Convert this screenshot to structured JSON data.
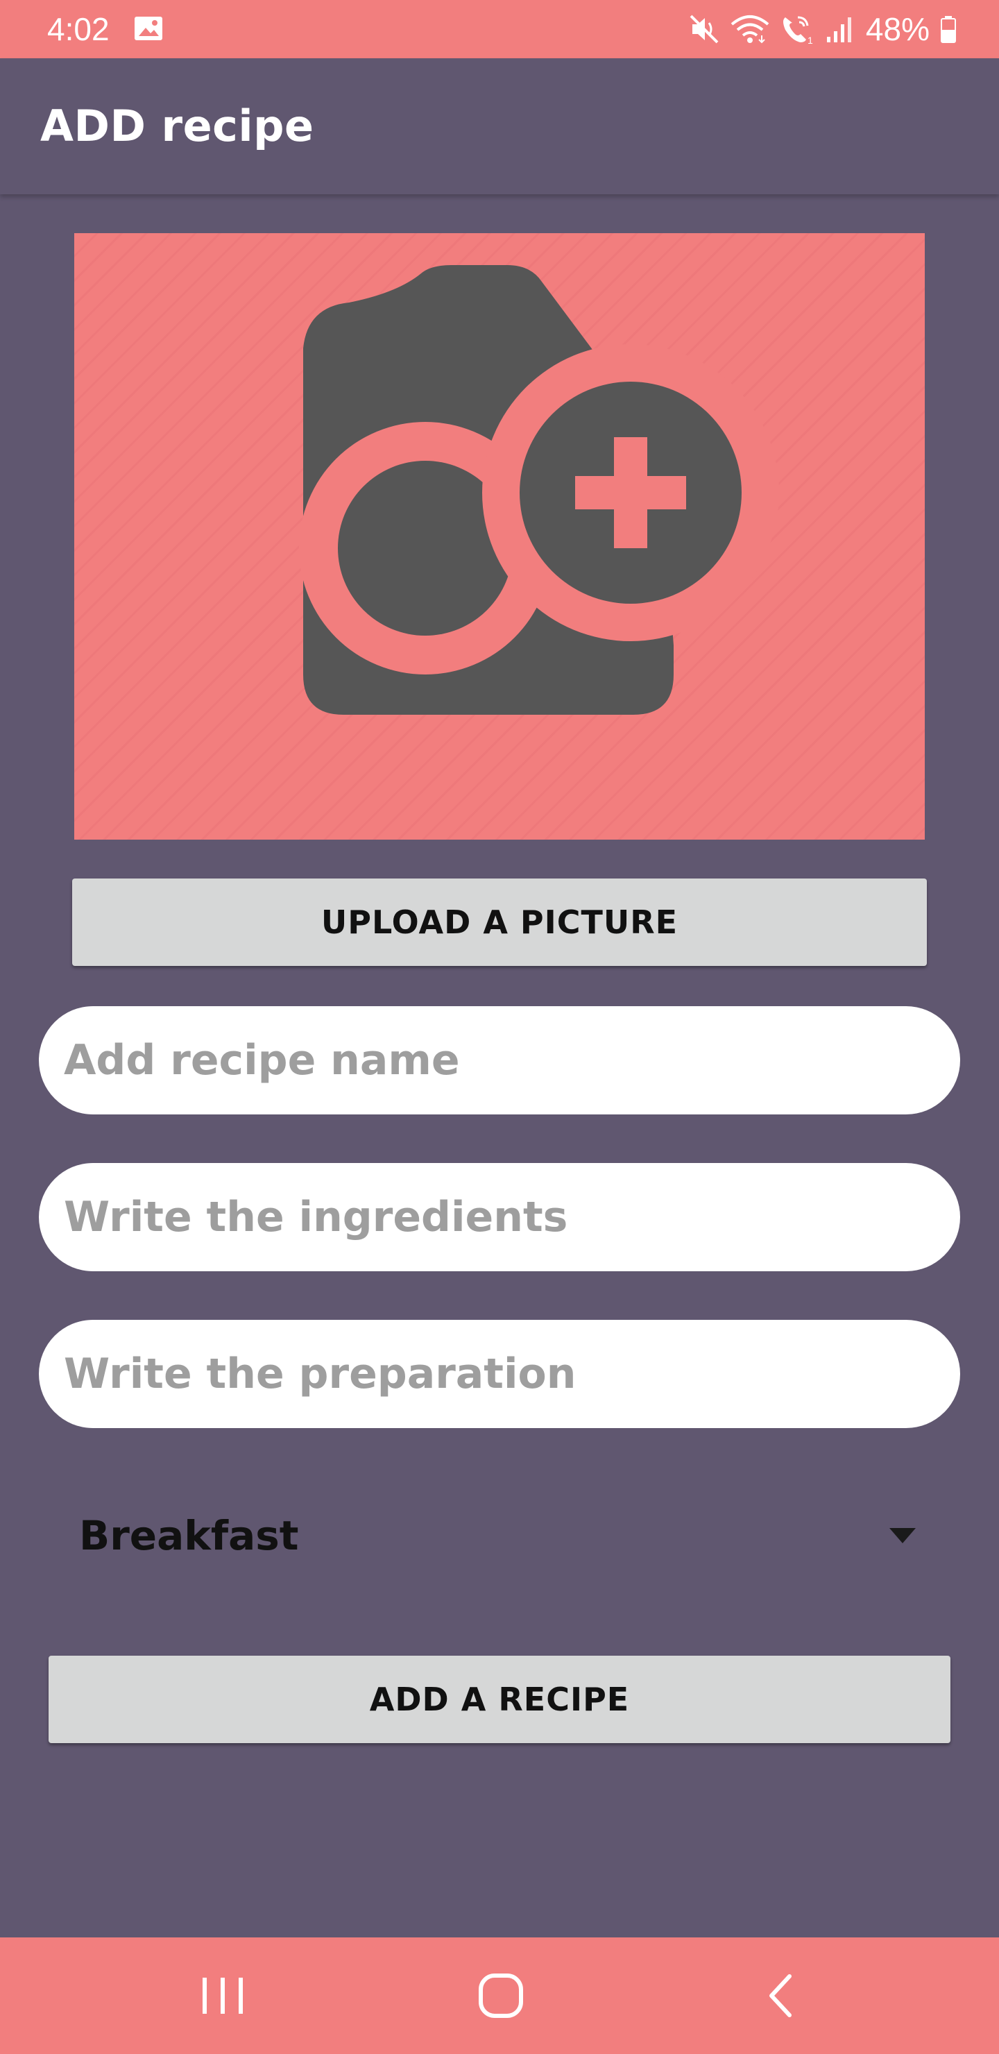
{
  "status_bar": {
    "time": "4:02",
    "battery": "48%",
    "icons": [
      "gallery-icon",
      "mute-icon",
      "wifi-icon",
      "wifi-calling-icon",
      "signal-icon",
      "battery-icon"
    ]
  },
  "app_bar": {
    "title": "ADD recipe"
  },
  "image_placeholder": {
    "icon": "add-photo-icon",
    "colors": {
      "background": "#f27e7e",
      "icon": "#565656"
    }
  },
  "upload_button": {
    "label": "UPLOAD A PICTURE"
  },
  "form": {
    "name_placeholder": "Add recipe name",
    "name_value": "",
    "ingredients_placeholder": "Write the ingredients",
    "ingredients_value": "",
    "preparation_placeholder": "Write the preparation",
    "preparation_value": ""
  },
  "category": {
    "selected": "Breakfast"
  },
  "add_button": {
    "label": "ADD A RECIPE"
  },
  "nav_bar": {
    "icons": [
      "recent-apps-icon",
      "home-icon",
      "back-icon"
    ]
  },
  "colors": {
    "background": "#605770",
    "accent": "#f27e7e",
    "button": "#d6d7d7",
    "input": "#ffffff",
    "placeholder_text": "#9e9e9e"
  }
}
